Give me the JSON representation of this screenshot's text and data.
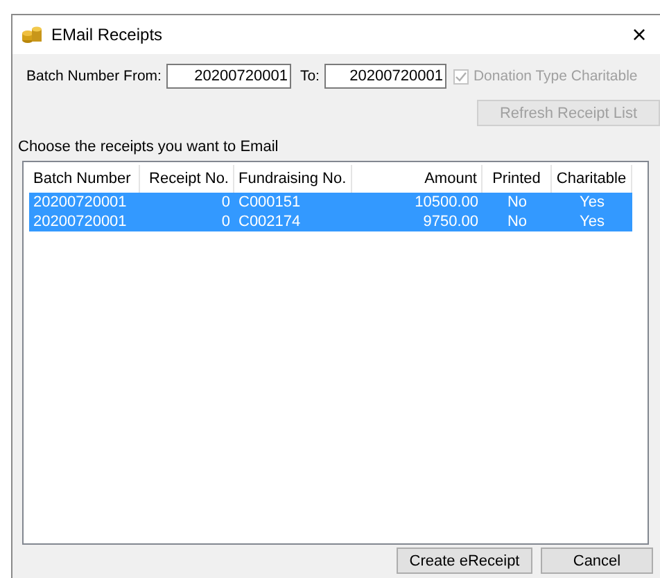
{
  "window": {
    "title": "EMail Receipts",
    "close": "×"
  },
  "batch_from": {
    "label": "Batch  Number From:",
    "value": "20200720001"
  },
  "batch_to": {
    "label": "To:",
    "value": "20200720001"
  },
  "charitable_checkbox": {
    "label": "Donation Type Charitable",
    "checked": true,
    "disabled": true
  },
  "refresh_button": {
    "label": "Refresh Receipt List",
    "disabled": true
  },
  "list_caption": "Choose the receipts you want to Email",
  "table": {
    "columns": [
      {
        "label": "Batch Number"
      },
      {
        "label": "Receipt No."
      },
      {
        "label": "Fundraising No."
      },
      {
        "label": "Amount"
      },
      {
        "label": "Printed"
      },
      {
        "label": "Charitable"
      }
    ],
    "rows": [
      {
        "cells": [
          "20200720001",
          "0",
          "C000151",
          "10500.00",
          "No",
          "Yes"
        ],
        "selected": true
      },
      {
        "cells": [
          "20200720001",
          "0",
          "C002174",
          "9750.00",
          "No",
          "Yes"
        ],
        "selected": true
      }
    ]
  },
  "buttons": [
    "Create eReceipt",
    "Cancel"
  ]
}
